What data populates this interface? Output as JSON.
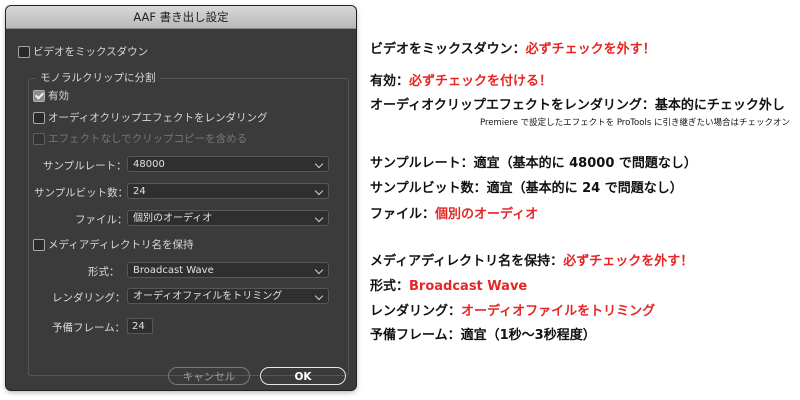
{
  "dialog": {
    "title": "AAF 書き出し設定",
    "mixdown_label": "ビデオをミックスダウン",
    "split_group_label": "モノラルクリップに分割",
    "enable_label": "有効",
    "render_effects_label": "オーディオクリップエフェクトをレンダリング",
    "include_copies_label": "エフェクトなしでクリップコピーを含める",
    "sample_rate_label": "サンプルレート：",
    "sample_rate_value": "48000",
    "bit_depth_label": "サンプルビット数：",
    "bit_depth_value": "24",
    "file_label": "ファイル：",
    "file_value": "個別のオーディオ",
    "keep_media_label": "メディアディレクトリ名を保持",
    "format_label": "形式：",
    "format_value": "Broadcast Wave",
    "rendering_label": "レンダリング：",
    "rendering_value": "オーディオファイルをトリミング",
    "handles_label": "予備フレーム：",
    "handles_value": "24",
    "cancel_label": "キャンセル",
    "ok_label": "OK"
  },
  "notes": {
    "mixdown_prefix": "ビデオをミックスダウン：",
    "mixdown_text": "必ずチェックを外す！",
    "enable_prefix": "有効：",
    "enable_text": "必ずチェックを付ける！",
    "render_effects": "オーディオクリップエフェクトをレンダリング：基本的にチェック外し",
    "render_effects_sub": "Premiere で設定したエフェクトを ProTools に引き継ぎたい場合はチェックオン",
    "sample_rate": "サンプルレート：適宜（基本的に 48000 で問題なし）",
    "bit_depth": "サンプルビット数：適宜（基本的に 24 で問題なし）",
    "file_prefix": "ファイル：",
    "file_text": "個別のオーディオ",
    "keep_media_prefix": "メディアディレクトリ名を保持：",
    "keep_media_text": "必ずチェックを外す！",
    "format_prefix": "形式：",
    "format_text": "Broadcast Wave",
    "rendering_prefix": "レンダリング：",
    "rendering_text": "オーディオファイルをトリミング",
    "handles": "予備フレーム：適宜（1秒〜3秒程度）"
  },
  "colors": {
    "dialog_bg": "#3b3b3b",
    "highlight_red": "#e62525"
  }
}
